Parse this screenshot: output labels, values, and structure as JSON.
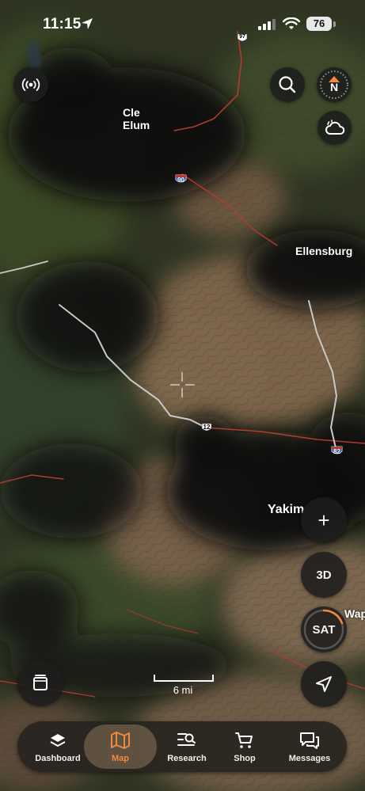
{
  "status_bar": {
    "time": "11:15",
    "battery": "76"
  },
  "map": {
    "labels": {
      "cle_elum": "Cle\nElum",
      "ellensburg": "Ellensburg",
      "yakima": "Yakim",
      "wapato": "Wap"
    },
    "route_shields": {
      "i90": "90",
      "i82": "82",
      "us12": "12",
      "sr97": "97"
    },
    "scale_label": "6 mi"
  },
  "controls": {
    "zoom_in": "+",
    "three_d": "3D",
    "sat": "SAT"
  },
  "compass": {
    "letter": "N"
  },
  "bottom_nav": {
    "items": [
      {
        "label": "Dashboard",
        "icon": "dashboard-icon"
      },
      {
        "label": "Map",
        "icon": "map-icon",
        "active": true
      },
      {
        "label": "Research",
        "icon": "research-icon"
      },
      {
        "label": "Shop",
        "icon": "cart-icon"
      },
      {
        "label": "Messages",
        "icon": "messages-icon"
      }
    ]
  },
  "colors": {
    "accent": "#f08a3c",
    "panel": "#1c1c1c"
  }
}
